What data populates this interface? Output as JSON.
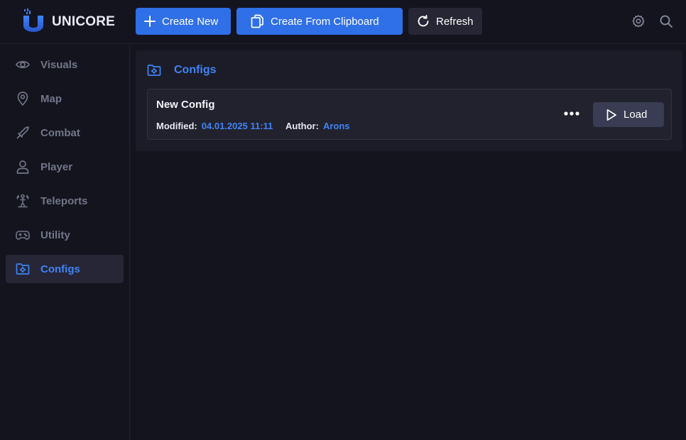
{
  "app": {
    "brand": "UNICORE"
  },
  "toolbar": {
    "create_new": "Create New",
    "create_from_clipboard": "Create From Clipboard",
    "refresh": "Refresh"
  },
  "sidebar": {
    "items": [
      {
        "label": "Visuals",
        "icon": "eye-icon"
      },
      {
        "label": "Map",
        "icon": "map-pin-icon"
      },
      {
        "label": "Combat",
        "icon": "sword-icon"
      },
      {
        "label": "Player",
        "icon": "user-icon"
      },
      {
        "label": "Teleports",
        "icon": "teleport-icon"
      },
      {
        "label": "Utility",
        "icon": "gamepad-icon"
      },
      {
        "label": "Configs",
        "icon": "folder-gear-icon",
        "active": true
      }
    ]
  },
  "main": {
    "title": "Configs",
    "configs": [
      {
        "name": "New Config",
        "modified_label": "Modified:",
        "modified": "04.01.2025 11:11",
        "author_label": "Author:",
        "author": "Arons",
        "load_label": "Load"
      }
    ]
  },
  "colors": {
    "accent": "#3f84f7",
    "primary_button": "#2f6fe8",
    "background": "#14141f",
    "panel": "#1c1c28"
  }
}
